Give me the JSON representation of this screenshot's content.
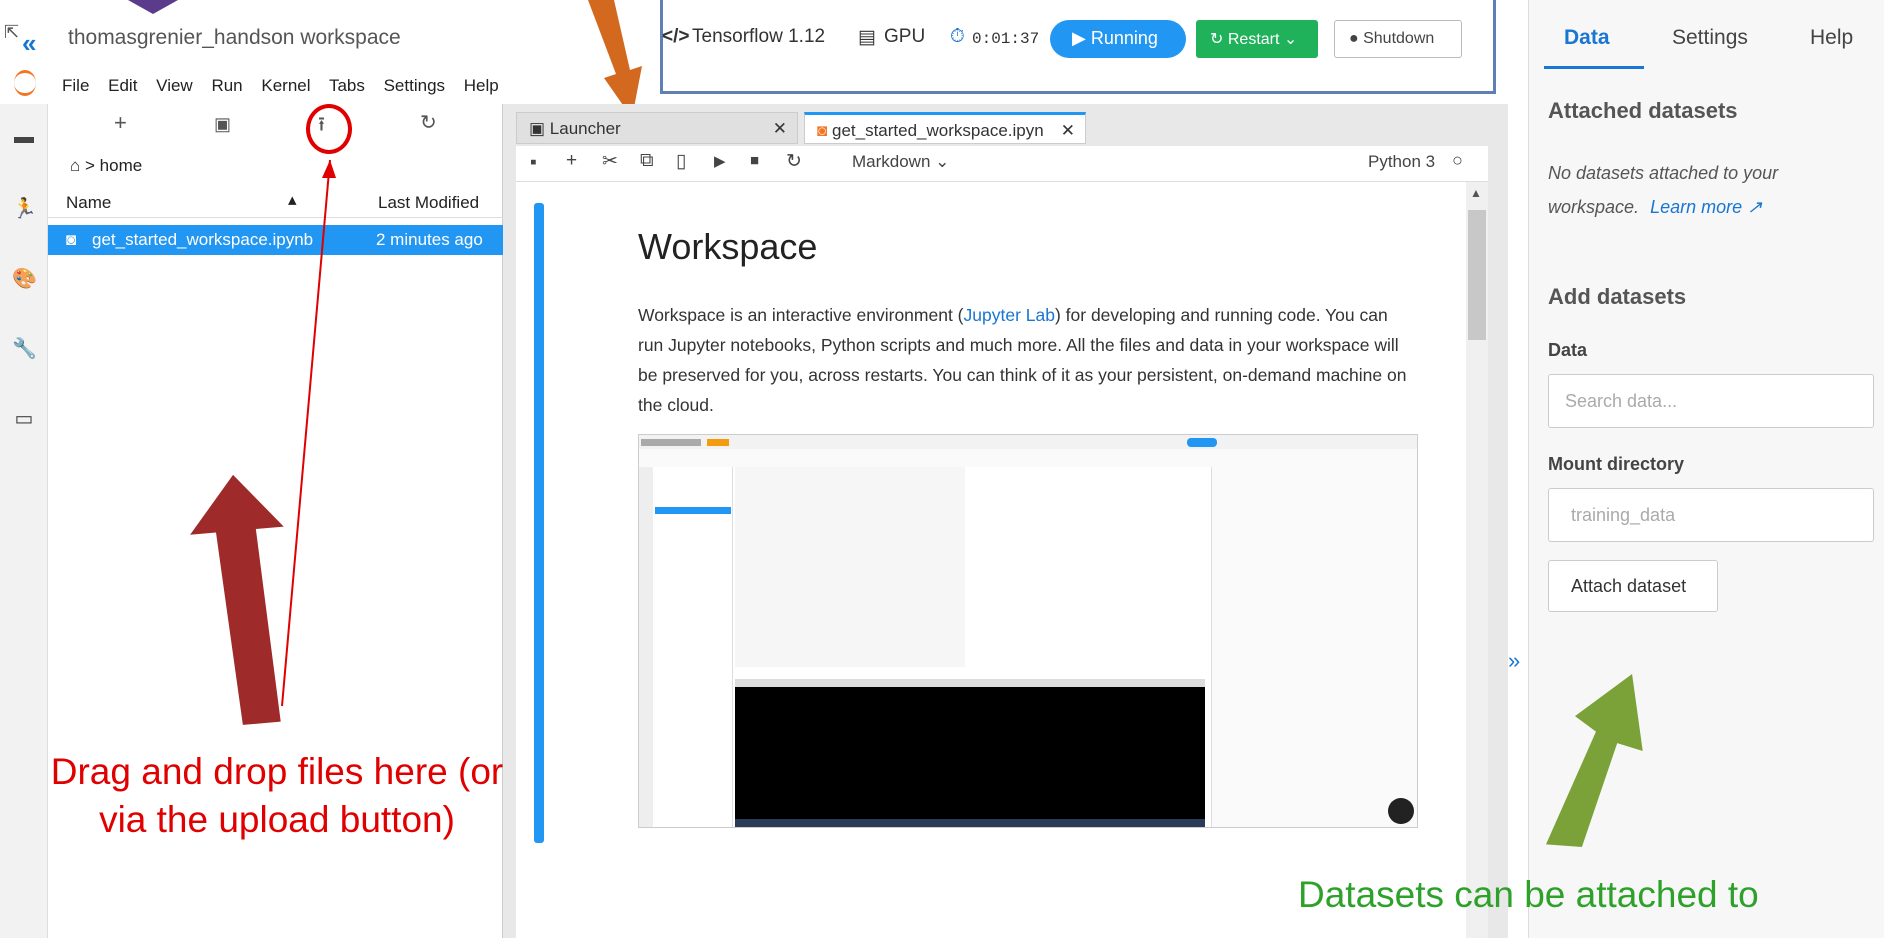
{
  "header": {
    "workspace_title": "thomasgrenier_handson workspace",
    "framework": "Tensorflow 1.12",
    "gpu_label": "GPU",
    "timer": "0:01:37",
    "running_label": "Running",
    "restart_label": "Restart",
    "shutdown_label": "Shutdown"
  },
  "menu": [
    "File",
    "Edit",
    "View",
    "Run",
    "Kernel",
    "Tabs",
    "Settings",
    "Help"
  ],
  "filebrowser": {
    "breadcrumb": "home",
    "col_name": "Name",
    "col_modified": "Last Modified",
    "files": [
      {
        "name": "get_started_workspace.ipynb",
        "modified": "2 minutes ago"
      }
    ]
  },
  "tabs": [
    {
      "label": "Launcher"
    },
    {
      "label": "get_started_workspace.ipyn"
    }
  ],
  "nb_toolbar": {
    "cell_type": "Markdown",
    "kernel": "Python 3"
  },
  "notebook": {
    "heading": "Workspace",
    "para_before_link": "Workspace is an interactive environment (",
    "link_text": "Jupyter Lab",
    "para_after_link": ") for developing and running code. You can run Jupyter notebooks, Python scripts and much more. All the files and data in your workspace will be preserved for you, across restarts. You can think of it as your persistent, on-demand machine on the cloud."
  },
  "right_panel": {
    "tabs": [
      "Data",
      "Settings",
      "Help"
    ],
    "attached_heading": "Attached datasets",
    "no_datasets_text": "No datasets attached to your workspace.",
    "learn_more": "Learn more",
    "add_heading": "Add datasets",
    "data_label": "Data",
    "search_placeholder": "Search data...",
    "mount_label": "Mount directory",
    "mount_value": "training_data",
    "attach_button": "Attach dataset"
  },
  "annotations": {
    "drag_drop": "Drag and drop files here (or via the upload button)",
    "datasets": "Datasets can be attached to"
  },
  "colors": {
    "accent": "#2196f3",
    "restart_green": "#1fb25a",
    "annot_red": "#e00000",
    "annot_green": "#2ea12a"
  }
}
